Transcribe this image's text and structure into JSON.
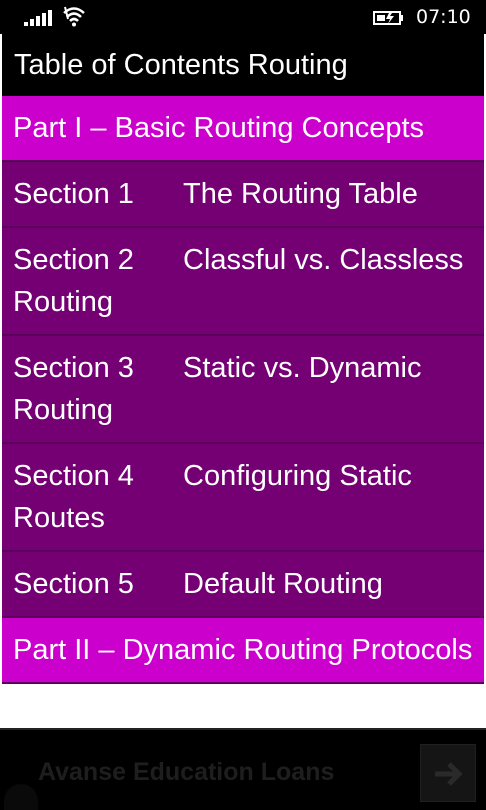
{
  "status_bar": {
    "time": "07:10",
    "icons": [
      "signal-icon",
      "wifi-icon",
      "battery-charging-icon"
    ]
  },
  "title": "Table of Contents Routing",
  "toc": [
    {
      "type": "part",
      "label": "Part I – Basic Routing Concepts"
    },
    {
      "type": "section",
      "number": "Section 1",
      "label": "The Routing Table"
    },
    {
      "type": "section",
      "number": "Section 2",
      "label": "Classful vs. Classless Routing"
    },
    {
      "type": "section",
      "number": "Section 3",
      "label": "Static vs. Dynamic Routing"
    },
    {
      "type": "section",
      "number": "Section 4",
      "label": "Configuring Static Routes"
    },
    {
      "type": "section",
      "number": "Section 5",
      "label": "Default Routing"
    },
    {
      "type": "part",
      "label": "Part II – Dynamic Routing Protocols"
    }
  ],
  "ad": {
    "text": "Avanse Education Loans",
    "icon": "arrow-right-icon"
  },
  "colors": {
    "part_bg": "#cc00cc",
    "section_bg": "#740074",
    "title_bg": "#000000",
    "text": "#ffffff"
  }
}
